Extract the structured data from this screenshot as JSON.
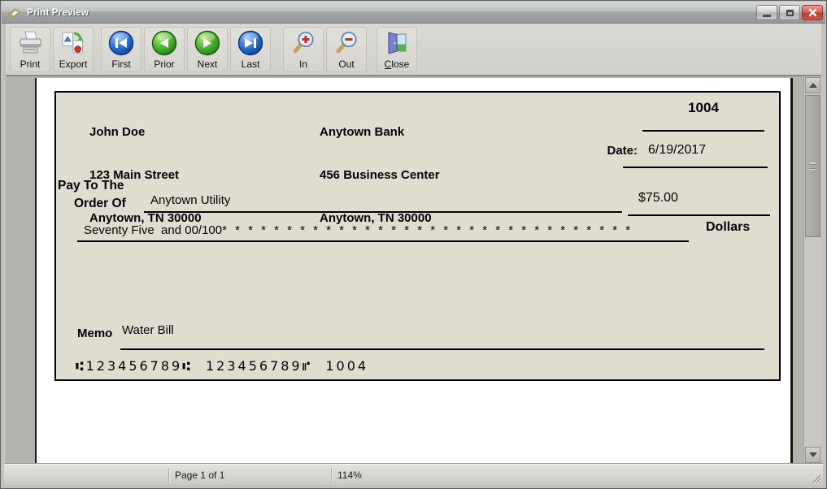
{
  "window": {
    "title": "Print Preview"
  },
  "toolbar": {
    "buttons": [
      {
        "label": "Print",
        "icon": "printer-icon"
      },
      {
        "label": "Export",
        "icon": "export-icon"
      },
      {
        "label": "First",
        "icon": "first-page-icon"
      },
      {
        "label": "Prior",
        "icon": "prior-page-icon"
      },
      {
        "label": "Next",
        "icon": "next-page-icon"
      },
      {
        "label": "Last",
        "icon": "last-page-icon"
      },
      {
        "label": "In",
        "icon": "zoom-in-icon"
      },
      {
        "label": "Out",
        "icon": "zoom-out-icon"
      },
      {
        "label": "Close",
        "icon": "door-exit-icon"
      }
    ]
  },
  "check": {
    "payer": {
      "name": "John Doe",
      "address1": "123 Main Street",
      "address2": "Anytown, TN 30000"
    },
    "bank": {
      "name": "Anytown Bank",
      "address1": "456 Business Center",
      "address2": "Anytown, TN 30000"
    },
    "check_number": "1004",
    "date_label": "Date:",
    "date_value": "6/19/2017",
    "pay_to_line1": "Pay To The",
    "pay_to_line2": "Order Of",
    "payee": "Anytown Utility",
    "amount": "$75.00",
    "amount_words": "Seventy Five  and 00/100",
    "amount_stars": "* * * * * * * * * * * * * * * * * * * * * * * * * * * * * * * *",
    "dollars_label": "Dollars",
    "memo_label": "Memo",
    "memo_value": "Water Bill",
    "micr_line": "⑆123456789⑆  123456789⑈  1004"
  },
  "statusbar": {
    "page_info": "Page 1 of 1",
    "zoom": "114%"
  },
  "colors": {
    "check_bg": "#dfddcf",
    "nav_blue": "#2a6fd6",
    "nav_green": "#4db32e",
    "close_button_red": "#d2564c",
    "magnifier_red": "#d42a1e"
  }
}
